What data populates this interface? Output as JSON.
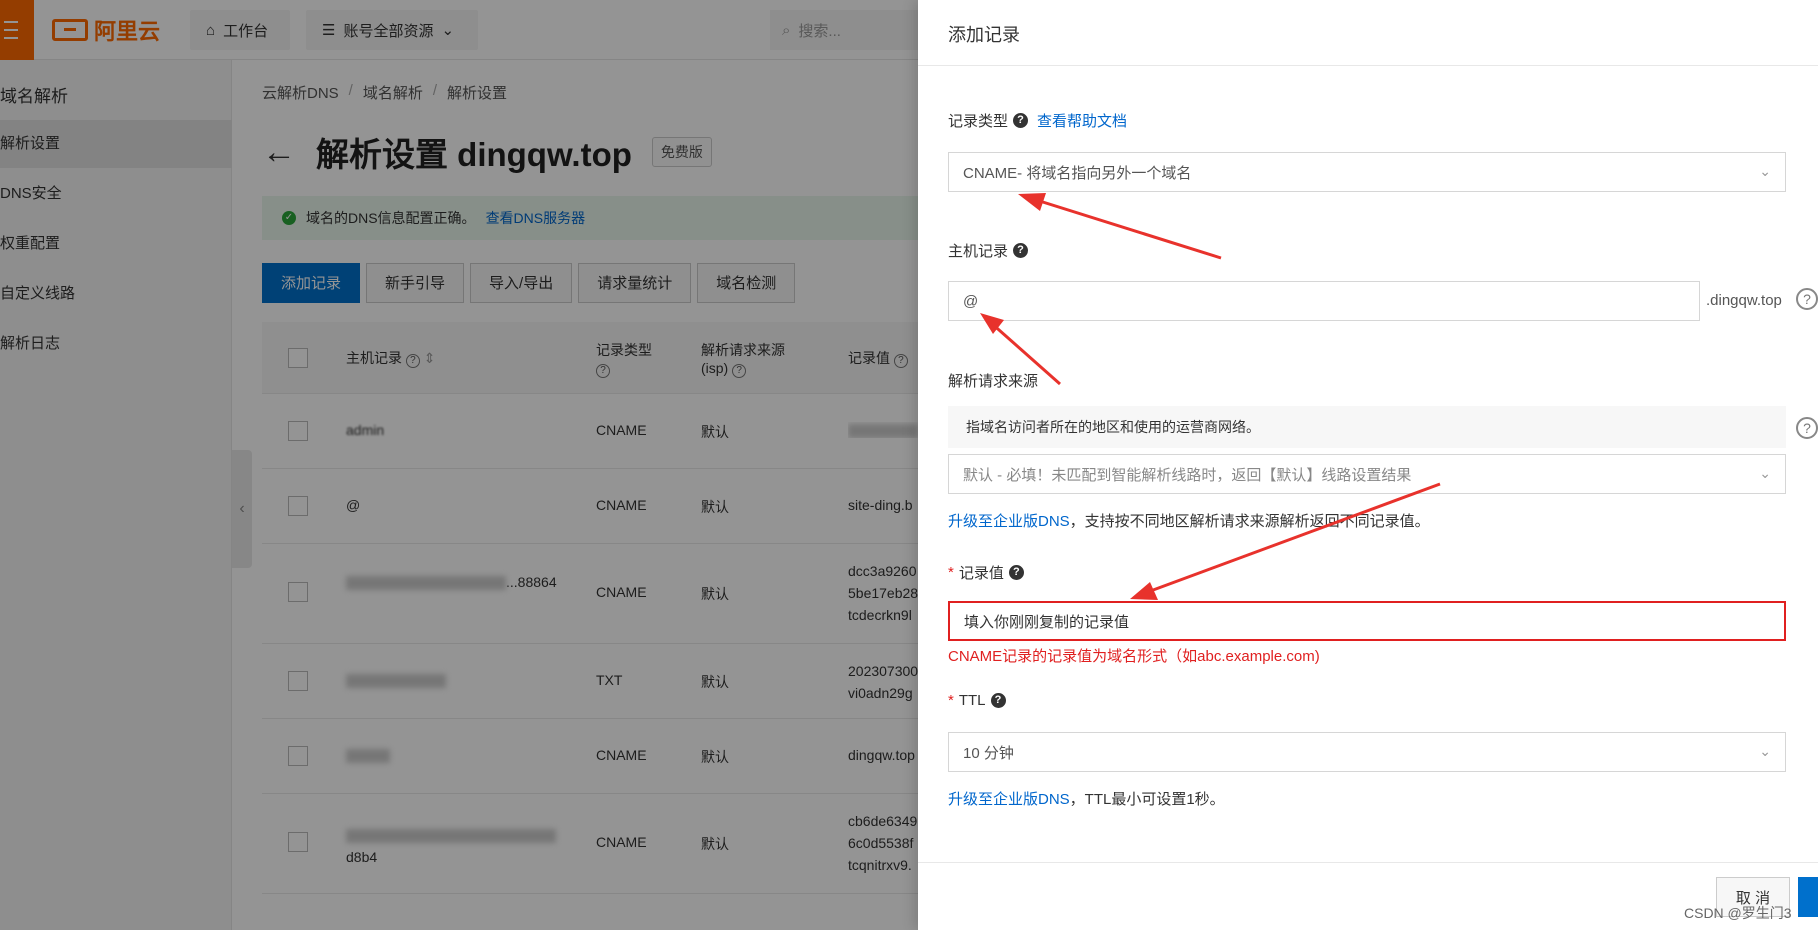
{
  "topbar": {
    "logo_text": "阿里云",
    "workbench_label": "工作台",
    "resources_label": "账号全部资源",
    "search_placeholder": "搜索..."
  },
  "sidebar": {
    "title": "域名解析",
    "items": [
      {
        "label": "解析设置",
        "active": true
      },
      {
        "label": "DNS安全"
      },
      {
        "label": "权重配置"
      },
      {
        "label": "自定义线路"
      },
      {
        "label": "解析日志"
      }
    ]
  },
  "breadcrumb": [
    "云解析DNS",
    "域名解析",
    "解析设置"
  ],
  "page": {
    "title": "解析设置 dingqw.top",
    "badge": "免费版",
    "notice_text": "域名的DNS信息配置正确。",
    "notice_link": "查看DNS服务器"
  },
  "actions": [
    "添加记录",
    "新手引导",
    "导入/导出",
    "请求量统计",
    "域名检测"
  ],
  "table": {
    "headers": {
      "host": "主机记录",
      "type": "记录类型",
      "source": "解析请求来源(isp)",
      "value": "记录值"
    },
    "rows": [
      {
        "host": "admin",
        "type": "CNAME",
        "source": "默认",
        "value": ""
      },
      {
        "host": "@",
        "type": "CNAME",
        "source": "默认",
        "value": "site-ding.b"
      },
      {
        "host": "...88864",
        "type": "CNAME",
        "source": "默认",
        "value": "dcc3a9260 5be17eb28 tcdecrkn9l"
      },
      {
        "host": "",
        "type": "TXT",
        "source": "默认",
        "value": "202307300 vi0adn29g"
      },
      {
        "host": "",
        "type": "CNAME",
        "source": "默认",
        "value": "dingqw.top"
      },
      {
        "host": "d8b4",
        "type": "CNAME",
        "source": "默认",
        "value": "cb6de6349 6c0d5538f tcqnitrxv9."
      }
    ]
  },
  "drawer": {
    "title": "添加记录",
    "record_type": {
      "label": "记录类型",
      "help_link": "查看帮助文档",
      "value": "CNAME- 将域名指向另外一个域名"
    },
    "host": {
      "label": "主机记录",
      "value": "@",
      "suffix": ".dingqw.top"
    },
    "source": {
      "label": "解析请求来源",
      "note": "指域名访问者所在的地区和使用的运营商网络。",
      "value": "默认 - 必填！未匹配到智能解析线路时，返回【默认】线路设置结果",
      "upgrade_link": "升级至企业版DNS",
      "upgrade_text": "，支持按不同地区解析请求来源解析返回不同记录值。"
    },
    "record_value": {
      "label": "记录值",
      "value": "填入你刚刚复制的记录值",
      "error": "CNAME记录的记录值为域名形式（如abc.example.com)"
    },
    "ttl": {
      "label": "TTL",
      "value": "10 分钟",
      "upgrade_link": "升级至企业版DNS",
      "upgrade_text": "，TTL最小可设置1秒。"
    },
    "cancel_label": "取 消"
  },
  "watermark": "CSDN @罗生门3",
  "colors": {
    "brand": "#ff6a00",
    "primary": "#0070cc",
    "error": "#e02020",
    "annotation_arrow": "#e8322c"
  }
}
